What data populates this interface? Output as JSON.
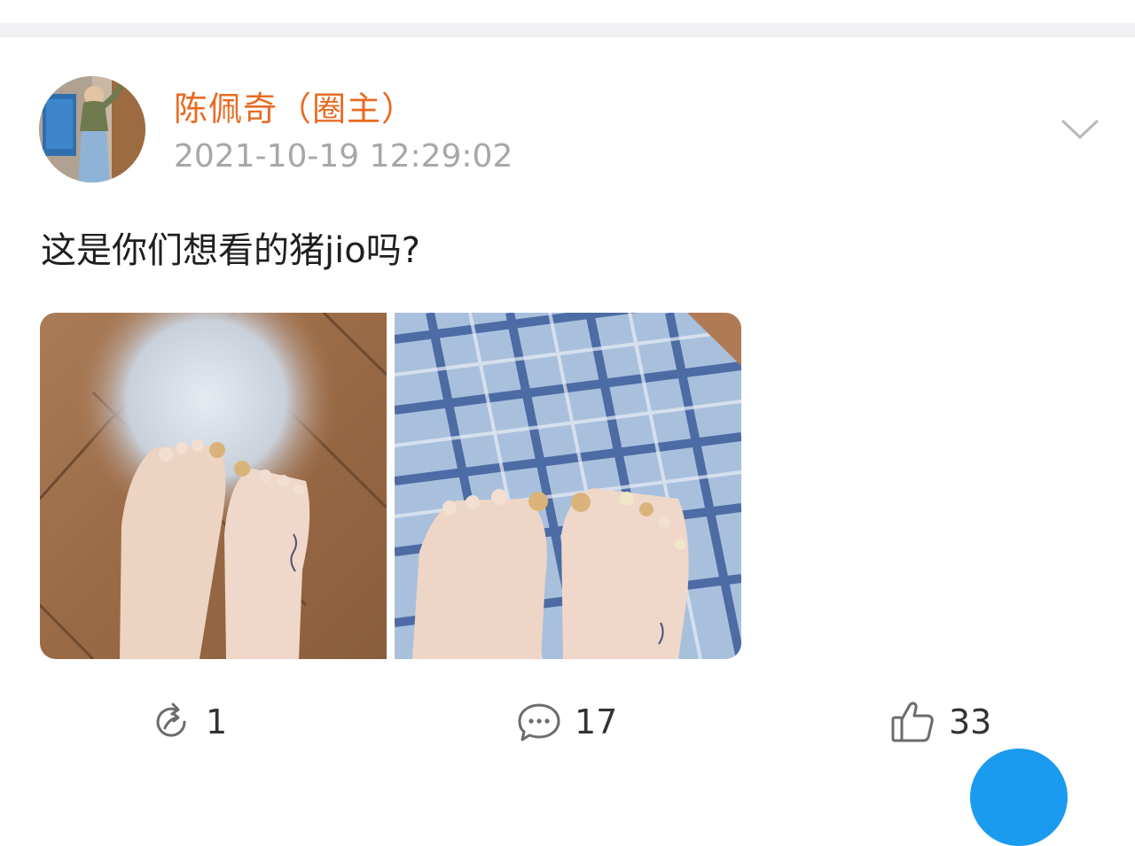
{
  "post": {
    "author_name": "陈佩奇（圈主）",
    "timestamp": "2021-10-19 12:29:02",
    "text": "这是你们想看的猪jio吗?",
    "images": [
      {
        "description": "feet-on-wood-floor-photo"
      },
      {
        "description": "feet-on-plaid-fabric-photo"
      }
    ]
  },
  "actions": {
    "repost_count": "1",
    "comment_count": "17",
    "like_count": "33"
  },
  "colors": {
    "author_name": "#e86b22",
    "timestamp": "#a7a7ab",
    "divider": "#f1f1f3",
    "fab": "#1a9bf0"
  },
  "icons": [
    "chevron-down-icon",
    "repost-icon",
    "comment-icon",
    "thumbs-up-icon"
  ]
}
